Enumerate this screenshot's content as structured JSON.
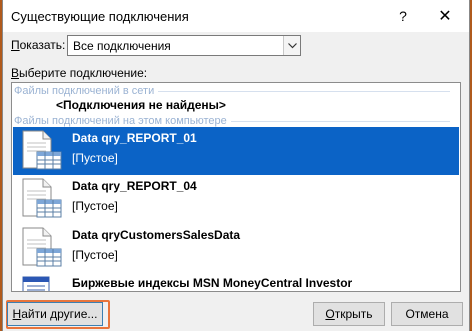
{
  "window": {
    "title": "Существующие подключения",
    "help_glyph": "?",
    "close_glyph": "✕"
  },
  "filter": {
    "label": "Показать:",
    "label_accel": "П",
    "label_rest": "оказать:",
    "selected": "Все подключения"
  },
  "list": {
    "label": "Выберите подключение:",
    "label_accel": "В",
    "label_rest": "ыберите подключение:",
    "groups": [
      {
        "header": "Файлы подключений в сети",
        "empty_text": "<Подключения не найдены>"
      },
      {
        "header": "Файлы подключений на этом компьютере"
      }
    ],
    "items": [
      {
        "name": "Data qry_REPORT_01",
        "description": "[Пустое]",
        "selected": true
      },
      {
        "name": "Data qry_REPORT_04",
        "description": "[Пустое]",
        "selected": false
      },
      {
        "name": "Data qryCustomersSalesData",
        "description": "[Пустое]",
        "selected": false
      },
      {
        "name": "Биржевые индексы MSN MoneyCentral Investor",
        "description": "",
        "selected": false
      }
    ]
  },
  "buttons": {
    "find_more": "Найти другие...",
    "find_accel": "Н",
    "find_rest": "айти другие...",
    "open": "Открыть",
    "open_accel": "О",
    "open_rest": "ткрыть",
    "cancel": "Отмена"
  },
  "colors": {
    "selection": "#0b63c6",
    "highlight_border": "#e8743b",
    "group_header_text": "#9bb3d3"
  }
}
